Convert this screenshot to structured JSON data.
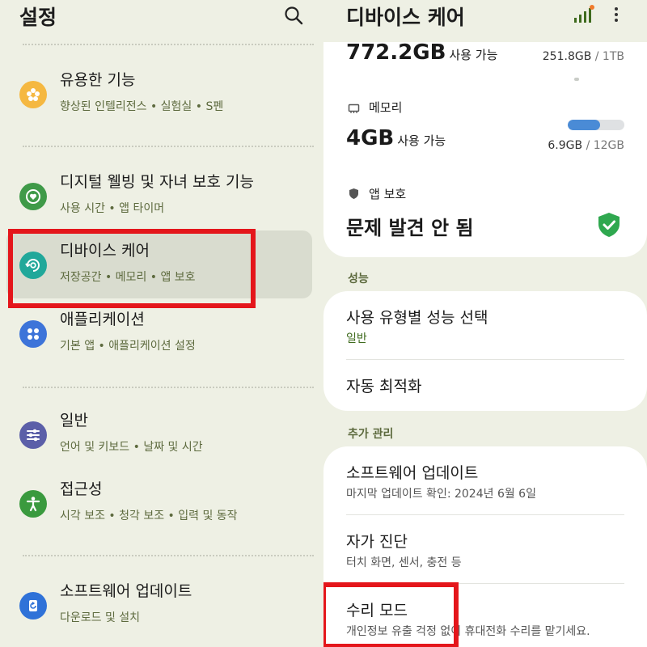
{
  "left": {
    "title": "설정",
    "items": [
      {
        "icon": "bulb-icon",
        "title": "유용한 기능",
        "subtitle": "향상된 인텔리전스 • 실험실 • S펜",
        "color": "#f5b841"
      },
      {
        "icon": "heart-leaf-icon",
        "title": "디지털 웰빙 및 자녀 보호 기능",
        "subtitle": "사용 시간 • 앱 타이머",
        "color": "#3f9a48"
      },
      {
        "icon": "device-care-icon",
        "title": "디바이스 케어",
        "subtitle": "저장공간 • 메모리 • 앱 보호",
        "color": "#21a89a"
      },
      {
        "icon": "apps-grid-icon",
        "title": "애플리케이션",
        "subtitle": "기본 앱 • 애플리케이션 설정",
        "color": "#3d74d9"
      },
      {
        "icon": "sliders-icon",
        "title": "일반",
        "subtitle": "언어 및 키보드 • 날짜 및 시간",
        "color": "#5b5fa8"
      },
      {
        "icon": "accessibility-icon",
        "title": "접근성",
        "subtitle": "시각 보조 • 청각 보조 • 입력 및 동작",
        "color": "#3a9a3e"
      },
      {
        "icon": "software-update-icon",
        "title": "소프트웨어 업데이트",
        "subtitle": "다운로드 및 설치",
        "color": "#2f72d8"
      }
    ]
  },
  "right": {
    "title": "디바이스 케어",
    "storage": {
      "available": "772.2GB",
      "available_suffix": "사용 가능",
      "used": "251.8GB",
      "total": "/ 1TB"
    },
    "memory": {
      "label": "메모리",
      "available": "4GB",
      "available_suffix": "사용 가능",
      "used": "6.9GB",
      "total": "/ 12GB",
      "usage_fraction": 0.575
    },
    "app_protection": {
      "label": "앱 보호",
      "status": "문제 발견 안 됨"
    },
    "performance": {
      "section": "성능",
      "items": [
        {
          "title": "사용 유형별 성능 선택",
          "subtitle": "일반"
        },
        {
          "title": "자동 최적화"
        }
      ]
    },
    "extra": {
      "section": "추가 관리",
      "items": [
        {
          "title": "소프트웨어 업데이트",
          "subtitle": "마지막 업데이트 확인: 2024년 6월 6일"
        },
        {
          "title": "자가 진단",
          "subtitle": "터치 화면, 센서, 충전 등"
        },
        {
          "title": "수리 모드",
          "subtitle": "개인정보 유출 걱정 없이 휴대전화 수리를 맡기세요."
        }
      ]
    }
  },
  "colors": {
    "highlight": "#e4161b",
    "accent_green": "#5d6a3e",
    "memory_bar": "#4a8bd6",
    "shield_green": "#2fa84f"
  }
}
